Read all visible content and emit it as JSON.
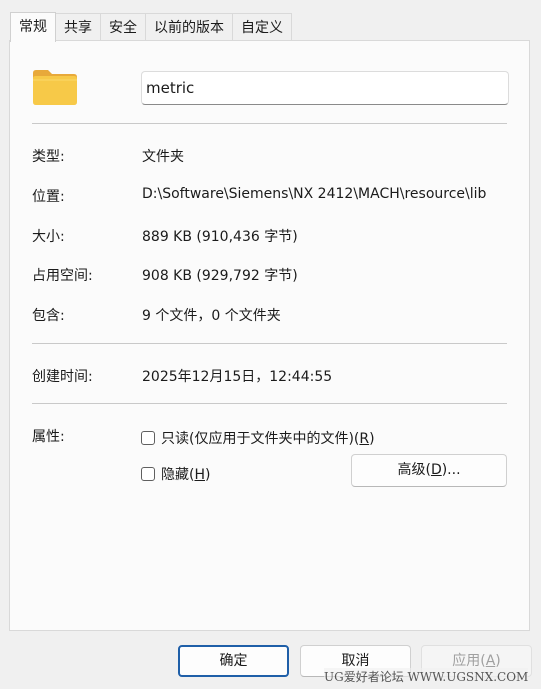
{
  "tabs": [
    {
      "label": "常规",
      "active": true
    },
    {
      "label": "共享",
      "active": false
    },
    {
      "label": "安全",
      "active": false
    },
    {
      "label": "以前的版本",
      "active": false
    },
    {
      "label": "自定义",
      "active": false
    }
  ],
  "icon": "folder-icon",
  "folder_name": "metric",
  "properties": {
    "type": {
      "label": "类型:",
      "value": "文件夹"
    },
    "location": {
      "label": "位置:",
      "value": "D:\\Software\\Siemens\\NX 2412\\MACH\\resource\\lib"
    },
    "size": {
      "label": "大小:",
      "value": "889 KB (910,436 字节)"
    },
    "size_on_disk": {
      "label": "占用空间:",
      "value": "908 KB (929,792 字节)"
    },
    "contains": {
      "label": "包含:",
      "value": "9 个文件，0 个文件夹"
    },
    "created": {
      "label": "创建时间:",
      "value": "2025年12月15日，12:44:55"
    }
  },
  "attributes": {
    "label": "属性:",
    "readonly": {
      "prefix": "只读(仅应用于文件夹中的文件)(",
      "key": "R",
      "suffix": ")",
      "checked": false
    },
    "hidden": {
      "prefix": "隐藏(",
      "key": "H",
      "suffix": ")",
      "checked": false
    },
    "advanced": {
      "prefix": "高级(",
      "key": "D",
      "suffix": ")..."
    }
  },
  "buttons": {
    "ok": "确定",
    "cancel": "取消",
    "apply": {
      "prefix": "应用(",
      "key": "A",
      "suffix": ")"
    }
  },
  "watermark": "UG爱好者论坛 WWW.UGSNX.COM",
  "colors": {
    "accent": "#1f5fa8",
    "folder": "#f7c948"
  }
}
